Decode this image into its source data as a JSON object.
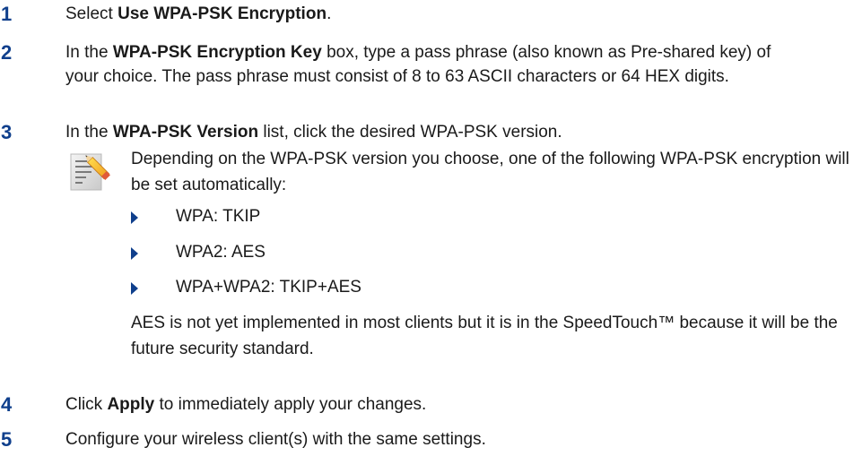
{
  "steps": [
    {
      "number": "1",
      "before": "Select ",
      "bold": "Use WPA-PSK Encryption",
      "after": "."
    },
    {
      "number": "2",
      "before": "In the ",
      "bold": "WPA-PSK Encryption Key",
      "after": " box, type a pass phrase (also known as Pre-shared key) of your choice. The pass phrase must consist of 8 to 63 ASCII characters or 64 HEX digits."
    },
    {
      "number": "3",
      "before": "In the ",
      "bold": "WPA-PSK Version",
      "after": " list, click the desired WPA-PSK version."
    },
    {
      "number": "4",
      "before": "Click ",
      "bold": "Apply",
      "after": " to immediately apply your changes."
    },
    {
      "number": "5",
      "before": "Configure your wireless client(s) with the same settings.",
      "bold": "",
      "after": ""
    }
  ],
  "note": {
    "icon": "note-pencil-icon",
    "text": "Depending on the WPA-PSK version you choose, one of the following WPA-PSK encryption will be set automatically:",
    "bullets": [
      "WPA: TKIP",
      "WPA2: AES",
      "WPA+WPA2: TKIP+AES"
    ],
    "after_text": "AES is not yet implemented in most clients but it is in the SpeedTouch™ because it will be the future security standard."
  },
  "colors": {
    "accent": "#0f3f8c",
    "text": "#1a1a1a"
  }
}
